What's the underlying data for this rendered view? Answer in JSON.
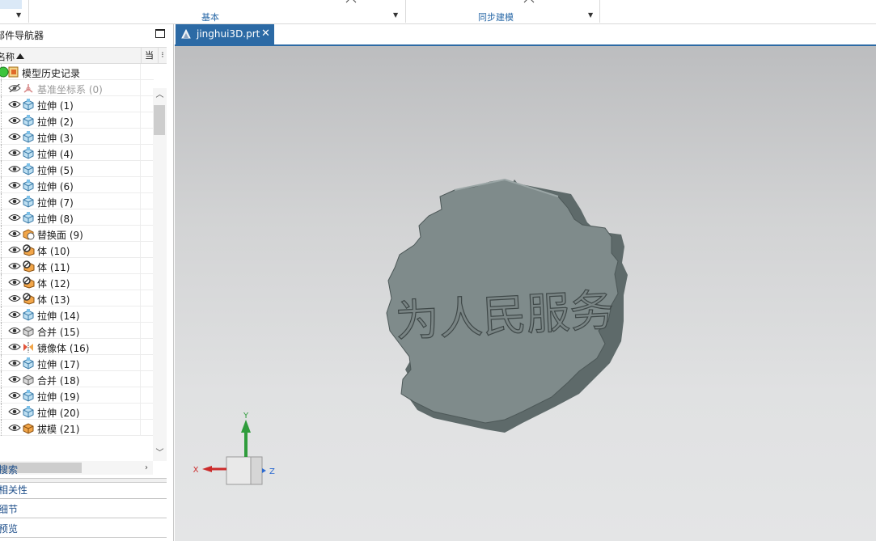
{
  "ribbon": {
    "groups": [
      {
        "label": "基本"
      },
      {
        "label": "同步建模"
      }
    ]
  },
  "navigator": {
    "title": "部件导航器",
    "header": {
      "name_col": "名称",
      "current_col": "当"
    },
    "items": [
      {
        "label": "模型历史记录",
        "icon": "history-icon",
        "root": true
      },
      {
        "label": "基准坐标系 (0)",
        "icon": "datum-csys-icon",
        "hidden": true
      },
      {
        "label": "拉伸 (1)",
        "icon": "extrude-icon"
      },
      {
        "label": "拉伸 (2)",
        "icon": "extrude-icon"
      },
      {
        "label": "拉伸 (3)",
        "icon": "extrude-icon"
      },
      {
        "label": "拉伸 (4)",
        "icon": "extrude-icon"
      },
      {
        "label": "拉伸 (5)",
        "icon": "extrude-icon"
      },
      {
        "label": "拉伸 (6)",
        "icon": "extrude-icon"
      },
      {
        "label": "拉伸 (7)",
        "icon": "extrude-icon"
      },
      {
        "label": "拉伸 (8)",
        "icon": "extrude-icon"
      },
      {
        "label": "替换面 (9)",
        "icon": "replace-face-icon"
      },
      {
        "label": "体 (10)",
        "icon": "body-icon"
      },
      {
        "label": "体 (11)",
        "icon": "body-icon"
      },
      {
        "label": "体 (12)",
        "icon": "body-icon"
      },
      {
        "label": "体 (13)",
        "icon": "body-icon"
      },
      {
        "label": "拉伸 (14)",
        "icon": "extrude-icon"
      },
      {
        "label": "合并 (15)",
        "icon": "unite-icon"
      },
      {
        "label": "镜像体 (16)",
        "icon": "mirror-body-icon"
      },
      {
        "label": "拉伸 (17)",
        "icon": "extrude-icon"
      },
      {
        "label": "合并 (18)",
        "icon": "unite-icon"
      },
      {
        "label": "拉伸 (19)",
        "icon": "extrude-icon"
      },
      {
        "label": "拉伸 (20)",
        "icon": "extrude-icon"
      },
      {
        "label": "拔模 (21)",
        "icon": "draft-icon"
      }
    ],
    "panels": [
      {
        "label": "搜索"
      },
      {
        "label": "相关性"
      },
      {
        "label": "细节"
      },
      {
        "label": "预览"
      }
    ]
  },
  "tab": {
    "label": "jinghui3D.prt",
    "close": "✕"
  },
  "model": {
    "engraved_text": "为人民服务"
  },
  "triad": {
    "x": "X",
    "y": "Y",
    "z": "Z"
  },
  "colors": {
    "accent": "#2c6aa5",
    "model_face": "#7f8b8b",
    "model_side": "#5e6a6a"
  }
}
